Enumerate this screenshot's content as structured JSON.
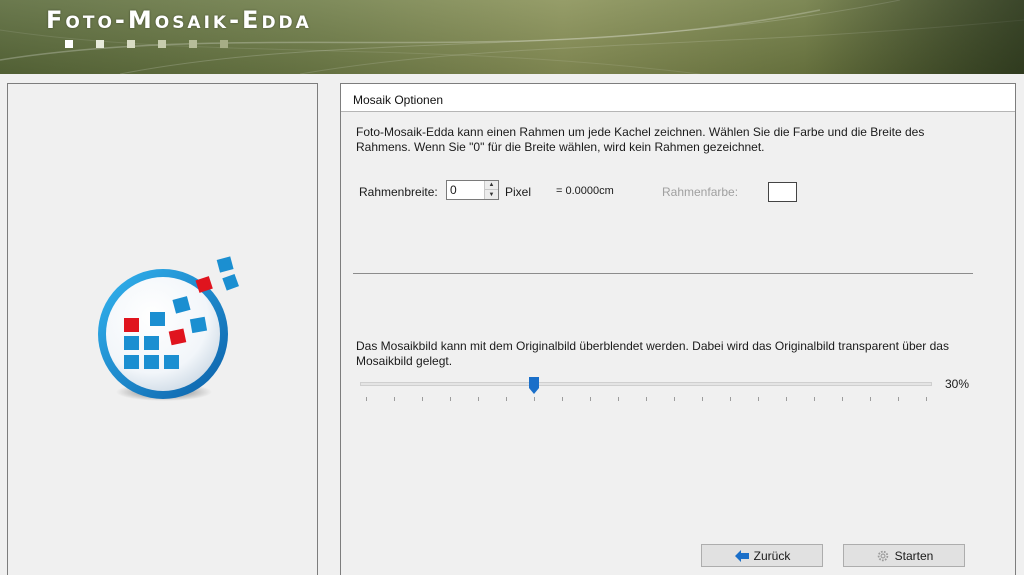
{
  "header": {
    "app_title": "Foto-Mosaik-Edda",
    "dot_colors": [
      "#ffffff",
      "#e8ebdc",
      "#d8dcc4",
      "#c7ccae",
      "#b6bc99",
      "#a6ad86"
    ]
  },
  "panel": {
    "title": "Mosaik Optionen",
    "frame_description": "Foto-Mosaik-Edda kann einen Rahmen um jede Kachel zeichnen. Wählen Sie die Farbe und die Breite des Rahmens. Wenn Sie \"0\" für die Breite wählen, wird kein Rahmen gezeichnet.",
    "frame_width_label": "Rahmenbreite:",
    "frame_width_value": "0",
    "frame_width_unit": "Pixel",
    "frame_width_cm": "= 0.0000cm",
    "frame_color_label": "Rahmenfarbe:",
    "frame_color": "#ffffff",
    "blend_description": "Das Mosaikbild kann mit dem Originalbild überblendet werden. Dabei wird das Originalbild transparent über das Mosaikbild gelegt.",
    "blend_value": 30,
    "blend_value_label": "30%"
  },
  "buttons": {
    "back_label": "Zurück",
    "start_label": "Starten"
  },
  "colors": {
    "accent_blue": "#1a6fc9",
    "logo_red": "#e0141e",
    "logo_tile_blue": "#1b8fd1"
  }
}
